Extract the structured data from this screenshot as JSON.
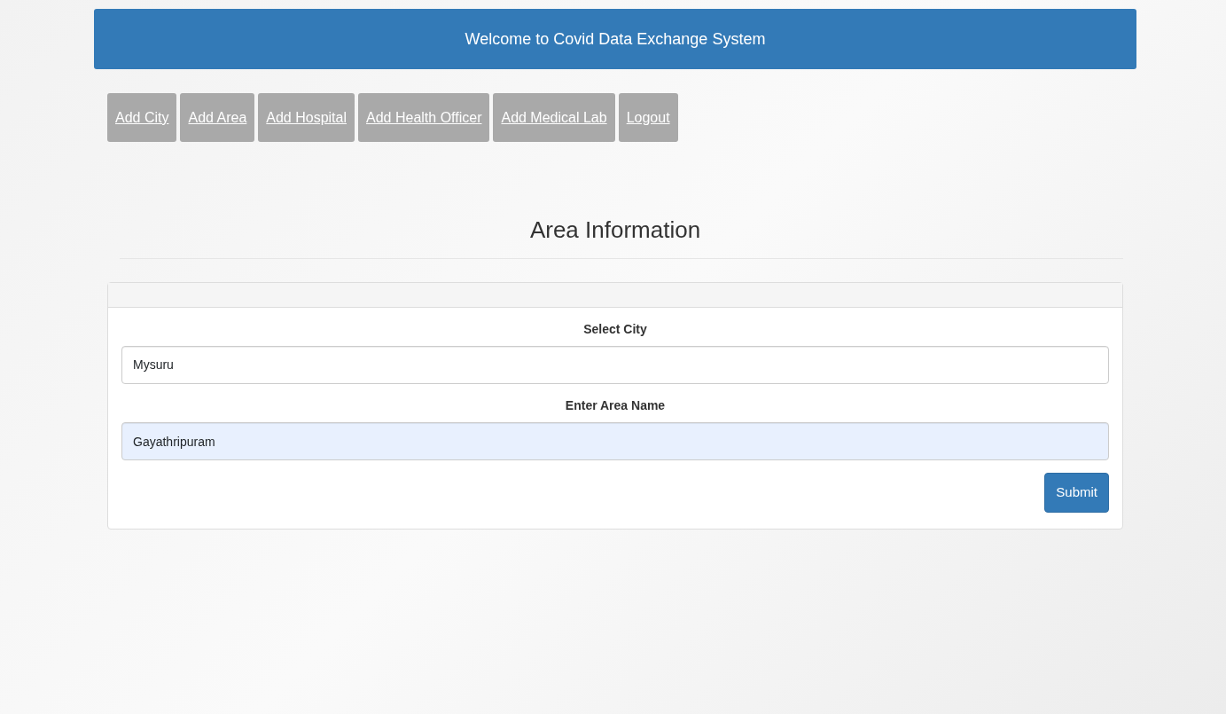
{
  "header": {
    "title": "Welcome to Covid Data Exchange System"
  },
  "nav_links": [
    {
      "label": "Add City"
    },
    {
      "label": "Add Area"
    },
    {
      "label": "Add Hospital"
    },
    {
      "label": "Add Health Officer"
    },
    {
      "label": "Add Medical Lab"
    },
    {
      "label": "Logout"
    }
  ],
  "page_title": "Area Information",
  "form": {
    "fields": [
      {
        "label": "Select City",
        "kind": "select",
        "value": "Mysuru",
        "autofilled": false
      },
      {
        "label": "Enter Area Name",
        "kind": "text",
        "value": "Gayathripuram",
        "autofilled": true
      }
    ],
    "submit": "Submit"
  }
}
